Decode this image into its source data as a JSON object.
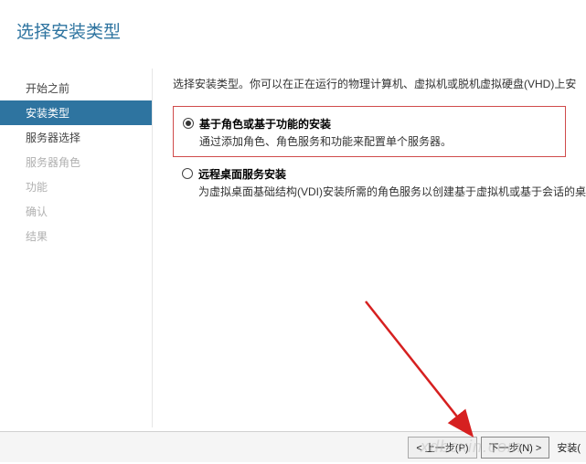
{
  "header": {
    "title": "选择安装类型"
  },
  "sidebar": {
    "items": [
      {
        "label": "开始之前",
        "state": "normal"
      },
      {
        "label": "安装类型",
        "state": "active"
      },
      {
        "label": "服务器选择",
        "state": "normal"
      },
      {
        "label": "服务器角色",
        "state": "disabled"
      },
      {
        "label": "功能",
        "state": "disabled"
      },
      {
        "label": "确认",
        "state": "disabled"
      },
      {
        "label": "结果",
        "state": "disabled"
      }
    ]
  },
  "main": {
    "intro": "选择安装类型。你可以在正在运行的物理计算机、虚拟机或脱机虚拟硬盘(VHD)上安",
    "options": [
      {
        "title": "基于角色或基于功能的安装",
        "desc": "通过添加角色、角色服务和功能来配置单个服务器。",
        "selected": true,
        "highlighted": true
      },
      {
        "title": "远程桌面服务安装",
        "desc": "为虚拟桌面基础结构(VDI)安装所需的角色服务以创建基于虚拟机或基于会话的桌",
        "selected": false,
        "highlighted": false
      }
    ]
  },
  "footer": {
    "prev": "< 上一步(P)",
    "next": "下一步(N) >",
    "install": "安装("
  },
  "watermark": "xdbcxin.com"
}
